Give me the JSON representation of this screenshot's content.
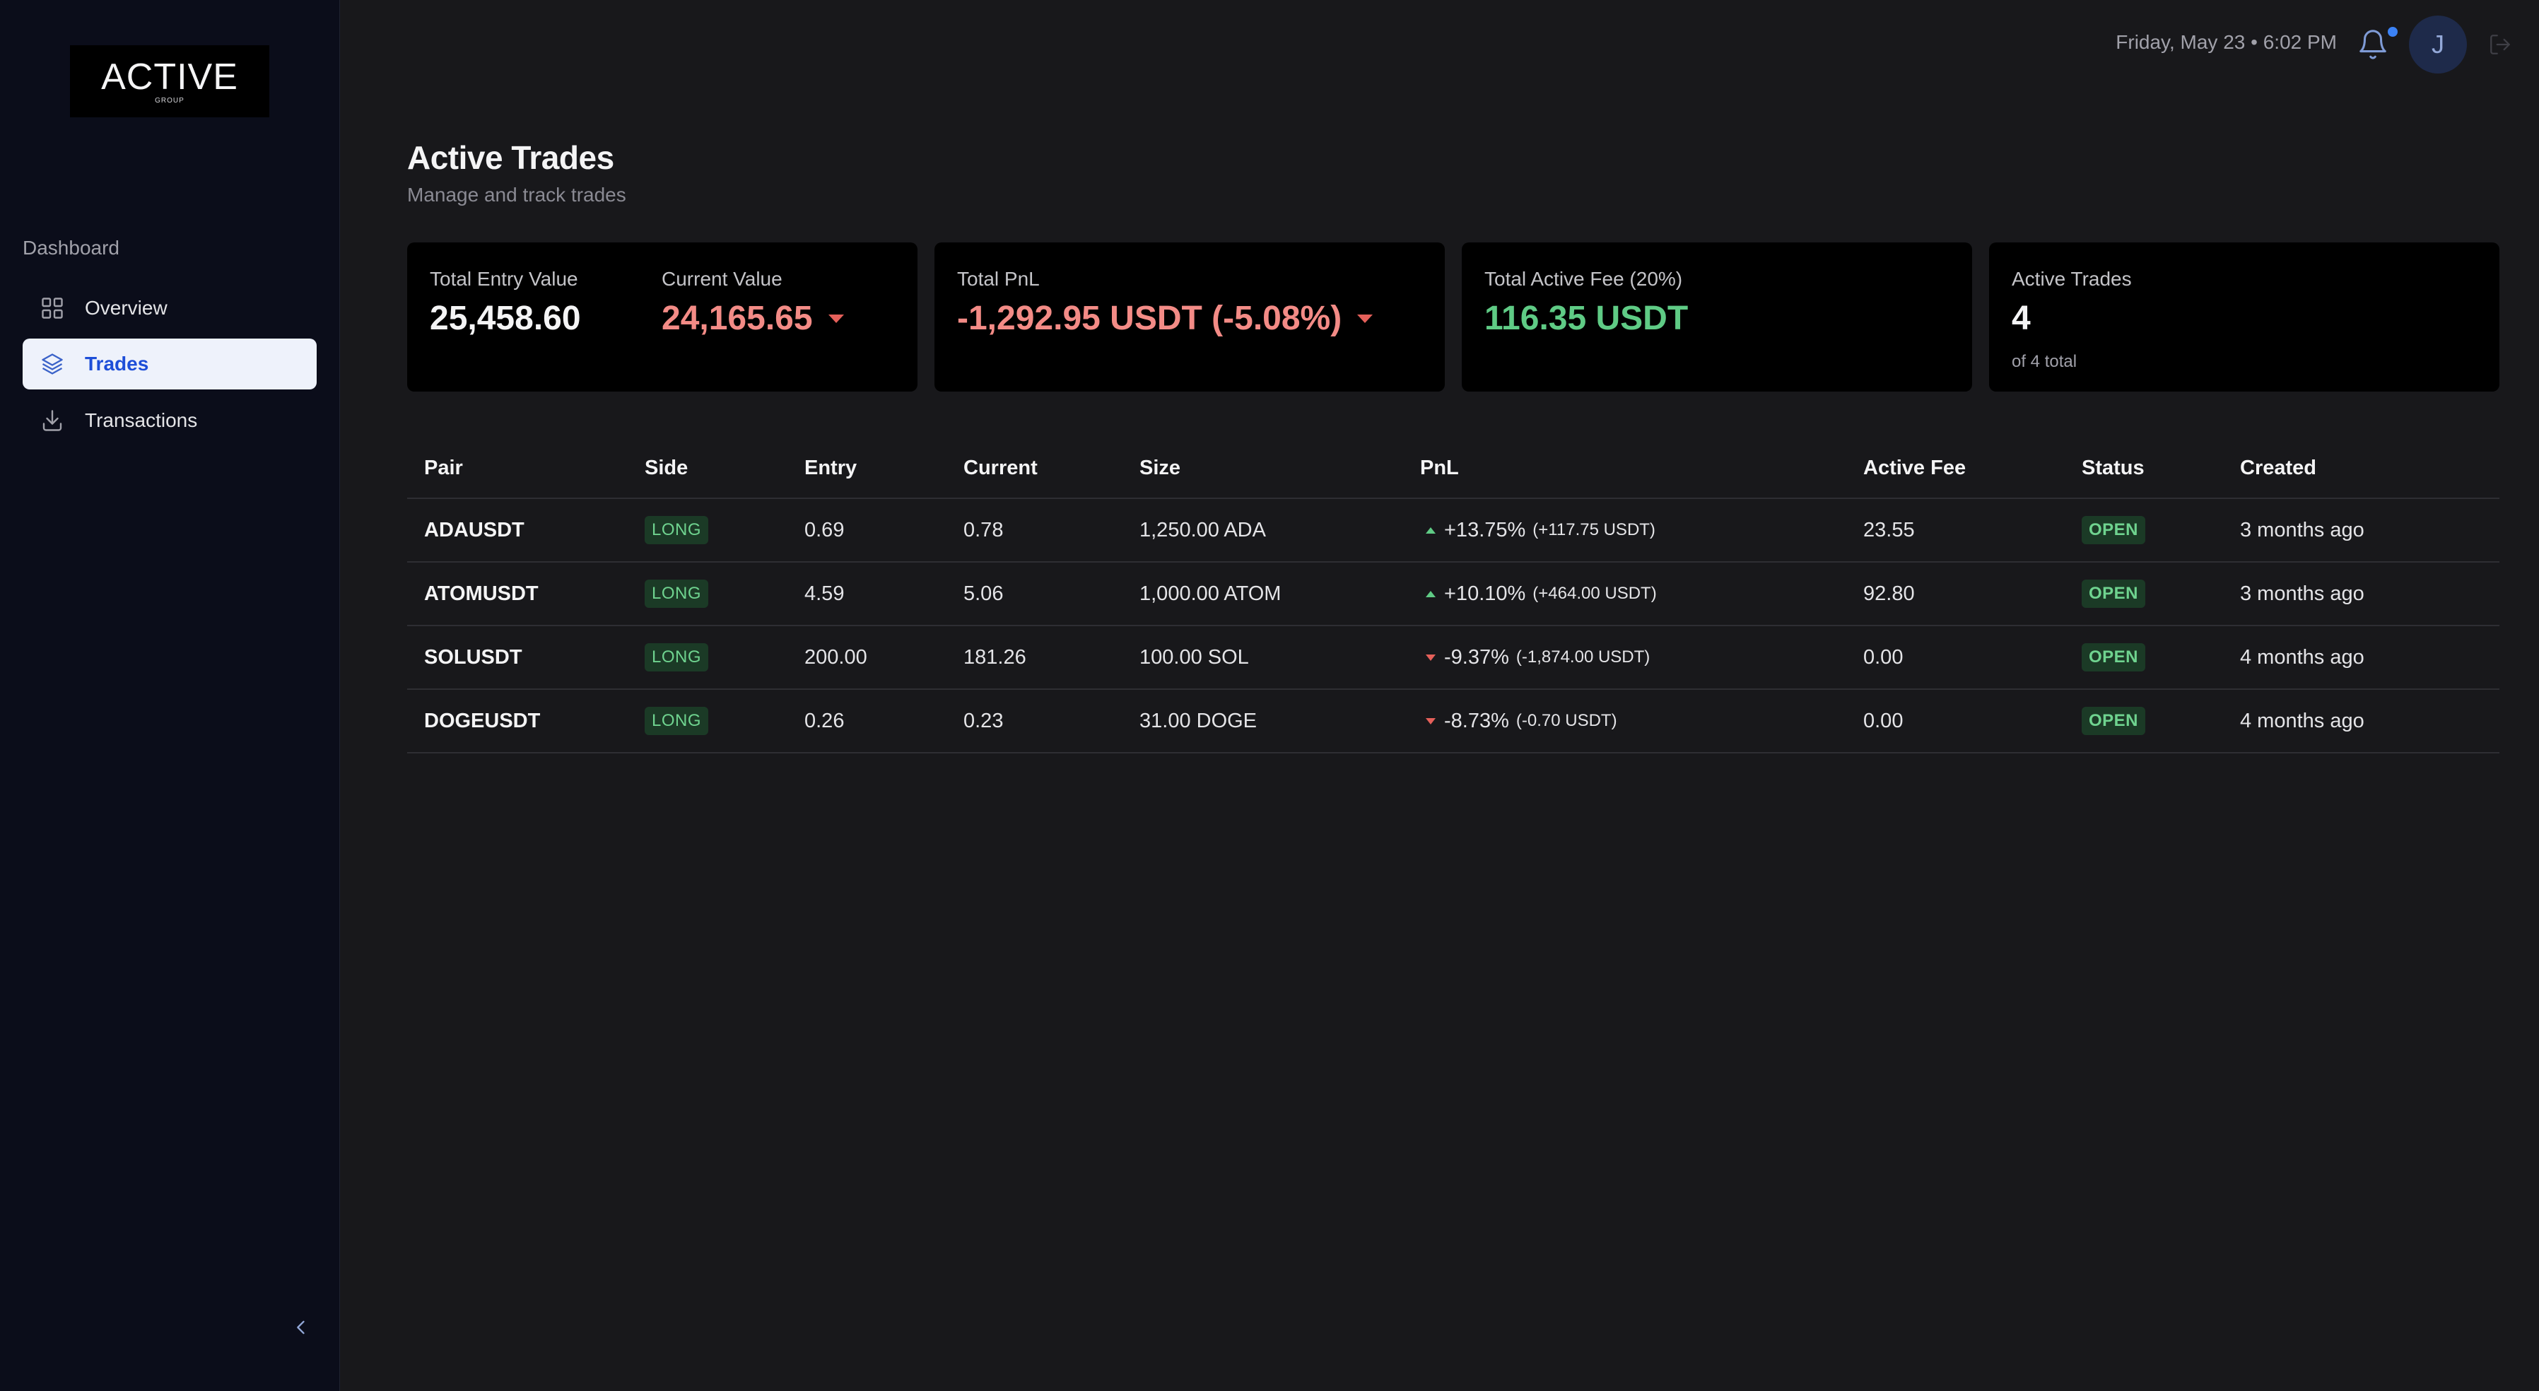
{
  "brand": {
    "name": "ACTIVE",
    "sub": "GROUP"
  },
  "sidebar": {
    "section": "Dashboard",
    "items": [
      {
        "label": "Overview",
        "icon": "grid-icon",
        "active": false
      },
      {
        "label": "Trades",
        "icon": "layers-icon",
        "active": true
      },
      {
        "label": "Transactions",
        "icon": "download-icon",
        "active": false
      }
    ]
  },
  "topbar": {
    "datetime": "Friday, May 23 • 6:02 PM",
    "avatar_initial": "J"
  },
  "header": {
    "title": "Active Trades",
    "subtitle": "Manage and track trades"
  },
  "cards": {
    "entry": {
      "label": "Total Entry Value",
      "value": "25,458.60"
    },
    "current": {
      "label": "Current Value",
      "value": "24,165.65"
    },
    "pnl": {
      "label": "Total PnL",
      "value": "-1,292.95 USDT (-5.08%)"
    },
    "fee": {
      "label": "Total Active Fee (20%)",
      "value": "116.35 USDT"
    },
    "active": {
      "label": "Active Trades",
      "value": "4",
      "sub": "of 4 total"
    }
  },
  "table": {
    "headers": {
      "pair": "Pair",
      "side": "Side",
      "entry": "Entry",
      "current": "Current",
      "size": "Size",
      "pnl": "PnL",
      "fee": "Active Fee",
      "status": "Status",
      "created": "Created"
    },
    "rows": [
      {
        "pair": "ADAUSDT",
        "side": "LONG",
        "entry": "0.69",
        "current": "0.78",
        "size": "1,250.00 ADA",
        "pnl_pct": "+13.75%",
        "pnl_abs": "(+117.75 USDT)",
        "fee": "23.55",
        "status": "OPEN",
        "created": "3 months ago"
      },
      {
        "pair": "ATOMUSDT",
        "side": "LONG",
        "entry": "4.59",
        "current": "5.06",
        "size": "1,000.00 ATOM",
        "pnl_pct": "+10.10%",
        "pnl_abs": "(+464.00 USDT)",
        "fee": "92.80",
        "status": "OPEN",
        "created": "3 months ago"
      },
      {
        "pair": "SOLUSDT",
        "side": "LONG",
        "entry": "200.00",
        "current": "181.26",
        "size": "100.00 SOL",
        "pnl_pct": "-9.37%",
        "pnl_abs": "(-1,874.00 USDT)",
        "fee": "0.00",
        "status": "OPEN",
        "created": "4 months ago"
      },
      {
        "pair": "DOGEUSDT",
        "side": "LONG",
        "entry": "0.26",
        "current": "0.23",
        "size": "31.00 DOGE",
        "pnl_pct": "-8.73%",
        "pnl_abs": "(-0.70 USDT)",
        "fee": "0.00",
        "status": "OPEN",
        "created": "4 months ago"
      }
    ]
  },
  "colors": {
    "positive": "#5fcb85",
    "negative": "#f38b86",
    "accent": "#3b82f6",
    "sidebar_bg": "#0b0d1a",
    "main_bg": "#18181b"
  }
}
